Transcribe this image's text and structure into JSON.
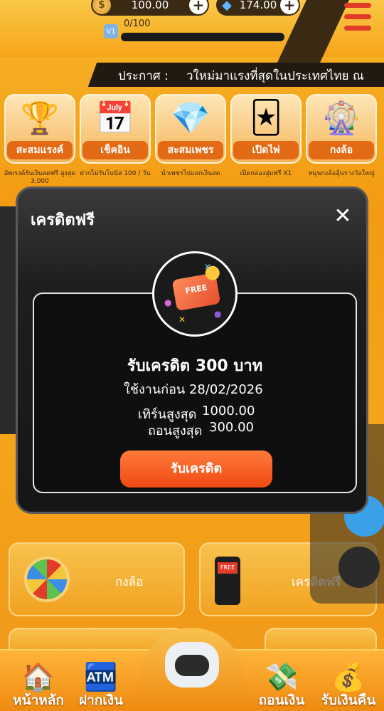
{
  "wallet": {
    "coins": "100.00",
    "gems": "174.00",
    "xp": "0/100",
    "level_badge": "V1"
  },
  "announcement": {
    "label": "ประกาศ :",
    "text": "วใหม่มาแรงที่สุดในประเทศไทย ณ"
  },
  "features": [
    {
      "title": "สะสมแรงค์",
      "subtitle": "อัพเรงค์รับเงินสดฟรี สูงสุด 3,000",
      "icon": "rank-v7-icon"
    },
    {
      "title": "เช็คอิน",
      "subtitle": "ฝากไม่รับโบนัส 100 / วัน",
      "icon": "calendar-icon"
    },
    {
      "title": "สะสมเพชร",
      "subtitle": "นำเพชรไปแลกเงินสด",
      "icon": "diamond-icon"
    },
    {
      "title": "เปิดไพ่",
      "subtitle": "เปิดกล่องสุ่มฟรี X1",
      "icon": "cards-icon"
    },
    {
      "title": "กงล้อ",
      "subtitle": "หมุนกงล้อลุ้นรางวัลใหญ่",
      "icon": "wheel-icon"
    }
  ],
  "modal": {
    "title": "เครดิตฟรี",
    "card_title": "รับเครดิต 300 บาท",
    "expiry": "ใช้งานก่อน 28/02/2026",
    "turnover_label": "เทิร์นสูงสุด",
    "turnover_value": "1000.00",
    "withdraw_label": "ถอนสูงสุด",
    "withdraw_value": "300.00",
    "claim_label": "รับเครดิต",
    "ticket_text": "FREE"
  },
  "cards": [
    {
      "label": "กงล้อ"
    },
    {
      "label": "เครดิตฟรี"
    }
  ],
  "nav": [
    {
      "label": "หน้าหลัก",
      "icon": "house-icon"
    },
    {
      "label": "ฝากเงิน",
      "icon": "deposit-icon"
    },
    {
      "label": "",
      "icon": "gamepad-icon"
    },
    {
      "label": "ถอนเงิน",
      "icon": "withdraw-icon"
    },
    {
      "label": "รับเงินคืน",
      "icon": "cashback-icon"
    }
  ],
  "colors": {
    "brand_orange": "#f5a51a",
    "button_orange": "#f04a14",
    "modal_bg": "#161616"
  }
}
